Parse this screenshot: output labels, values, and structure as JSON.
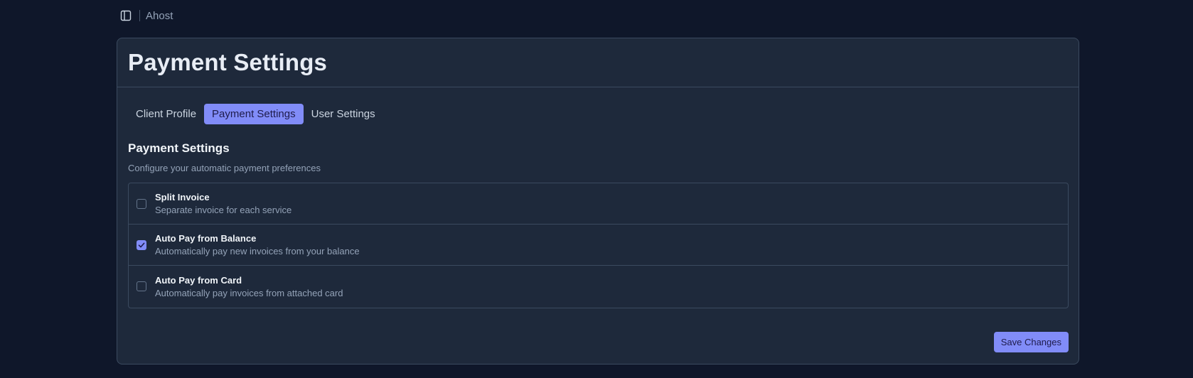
{
  "header": {
    "brand": "Ahost",
    "sidebar_toggle_icon": "sidebar-toggle-icon"
  },
  "card": {
    "title": "Payment Settings"
  },
  "tabs": [
    {
      "label": "Client Profile",
      "active": false
    },
    {
      "label": "Payment Settings",
      "active": true
    },
    {
      "label": "User Settings",
      "active": false
    }
  ],
  "section": {
    "title": "Payment Settings",
    "description": "Configure your automatic payment preferences"
  },
  "options": [
    {
      "label": "Split Invoice",
      "description": "Separate invoice for each service",
      "checked": false
    },
    {
      "label": "Auto Pay from Balance",
      "description": "Automatically pay new invoices from your balance",
      "checked": true
    },
    {
      "label": "Auto Pay from Card",
      "description": "Automatically pay invoices from attached card",
      "checked": false
    }
  ],
  "actions": {
    "save_label": "Save Changes"
  },
  "colors": {
    "background": "#0f172a",
    "card": "#1e293b",
    "accent": "#818cf8"
  }
}
